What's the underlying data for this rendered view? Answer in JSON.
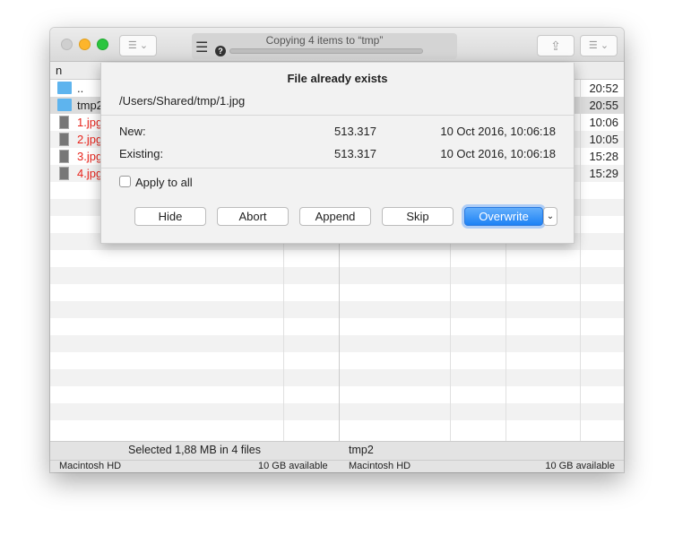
{
  "window": {
    "progress_title": "Copying 4 items to “tmp”",
    "progress": 0
  },
  "header": {
    "column_name": "n"
  },
  "files": [
    {
      "name": "..",
      "time": "20:52",
      "type": "folder",
      "color": "#222222"
    },
    {
      "name": "tmp2",
      "time": "20:55",
      "type": "folder",
      "color": "#222222",
      "selected": true
    },
    {
      "name": "1.jpg",
      "time": "10:06",
      "type": "image",
      "color": "#e8241c"
    },
    {
      "name": "2.jpg",
      "time": "10:05",
      "type": "image",
      "color": "#e8241c"
    },
    {
      "name": "3.jpg",
      "time": "15:28",
      "type": "image",
      "color": "#e8241c"
    },
    {
      "name": "4.jpg",
      "time": "15:29",
      "type": "image",
      "color": "#e8241c"
    }
  ],
  "status": {
    "left_selection": "Selected 1,88 MB in 4 files",
    "left_volume": "Macintosh HD",
    "left_free": "10 GB available",
    "right_path": "tmp2",
    "right_volume": "Macintosh HD",
    "right_free": "10 GB available"
  },
  "dialog": {
    "title": "File already exists",
    "path": "/Users/Shared/tmp/1.jpg",
    "new_label": "New:",
    "new_size": "513.317",
    "new_date": "10 Oct 2016, 10:06:18",
    "existing_label": "Existing:",
    "existing_size": "513.317",
    "existing_date": "10 Oct 2016, 10:06:18",
    "apply_all": "Apply to all",
    "apply_all_checked": false,
    "buttons": {
      "hide": "Hide",
      "abort": "Abort",
      "append": "Append",
      "skip": "Skip",
      "overwrite": "Overwrite"
    }
  },
  "colors": {
    "accent": "#1d82f5",
    "folder": "#5eb4ee",
    "marked": "#e8241c"
  }
}
